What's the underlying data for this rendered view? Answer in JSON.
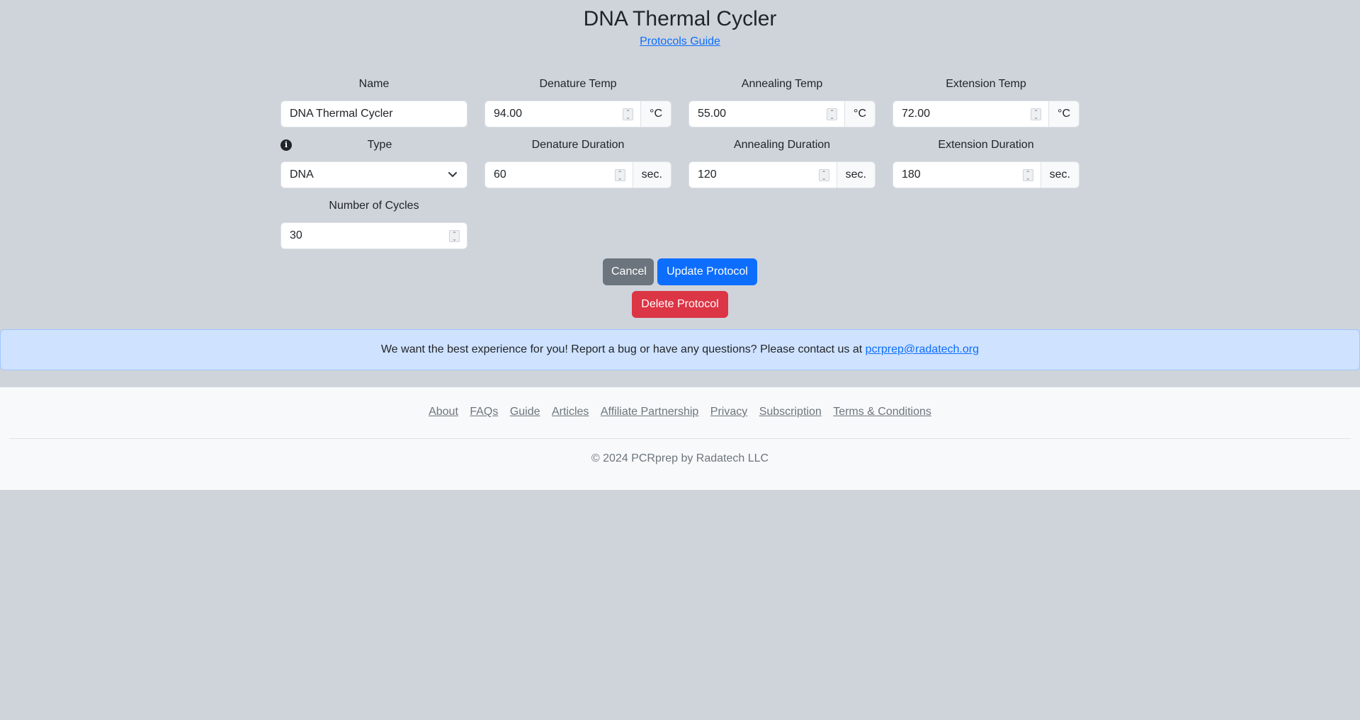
{
  "header": {
    "title": "DNA Thermal Cycler",
    "guide_link": "Protocols Guide"
  },
  "form": {
    "name": {
      "label": "Name",
      "value": "DNA Thermal Cycler"
    },
    "denature_temp": {
      "label": "Denature Temp",
      "value": "94.00",
      "unit": "°C"
    },
    "annealing_temp": {
      "label": "Annealing Temp",
      "value": "55.00",
      "unit": "°C"
    },
    "extension_temp": {
      "label": "Extension Temp",
      "value": "72.00",
      "unit": "°C"
    },
    "type": {
      "label": "Type",
      "value": "DNA"
    },
    "denature_duration": {
      "label": "Denature Duration",
      "value": "60",
      "unit": "sec."
    },
    "annealing_duration": {
      "label": "Annealing Duration",
      "value": "120",
      "unit": "sec."
    },
    "extension_duration": {
      "label": "Extension Duration",
      "value": "180",
      "unit": "sec."
    },
    "cycles": {
      "label": "Number of Cycles",
      "value": "30"
    }
  },
  "buttons": {
    "cancel": "Cancel",
    "update": "Update Protocol",
    "delete": "Delete Protocol"
  },
  "alert": {
    "message": "We want the best experience for you! Report a bug or have any questions? Please contact us at",
    "email": "pcrprep@radatech.org"
  },
  "footer": {
    "links": [
      "About",
      "FAQs",
      "Guide",
      "Articles",
      "Affiliate Partnership",
      "Privacy",
      "Subscription",
      "Terms & Conditions"
    ],
    "copyright": "© 2024 PCRprep by Radatech LLC"
  },
  "colors": {
    "background": "#cfd4db",
    "primary": "#0d6efd",
    "secondary": "#6c757d",
    "danger": "#dc3545",
    "alert_bg": "#cfe2ff"
  },
  "icons": {
    "type_info": "info-icon",
    "select_chevron": "chevron-down-icon"
  }
}
